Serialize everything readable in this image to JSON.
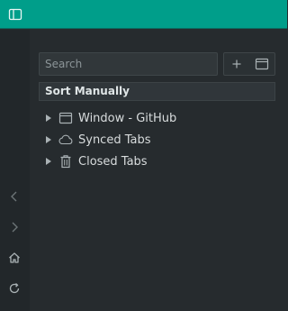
{
  "colors": {
    "accent": "#009e8a",
    "background": "#262b2e",
    "text": "#d8dcdd"
  },
  "topbar": {
    "toggle_icon": "sidebar-toggle-icon"
  },
  "rail": {
    "buttons": [
      {
        "icon": "back-icon"
      },
      {
        "icon": "forward-icon"
      },
      {
        "icon": "home-icon"
      },
      {
        "icon": "reload-icon"
      }
    ]
  },
  "panel": {
    "search": {
      "placeholder": "Search",
      "value": ""
    },
    "toolbar": {
      "add_icon": "plus-icon",
      "window_icon": "new-window-icon"
    },
    "sort_label": "Sort Manually",
    "items": [
      {
        "label": "Window - GitHub",
        "icon": "window-icon"
      },
      {
        "label": "Synced Tabs",
        "icon": "cloud-icon"
      },
      {
        "label": "Closed Tabs",
        "icon": "trash-icon"
      }
    ]
  }
}
